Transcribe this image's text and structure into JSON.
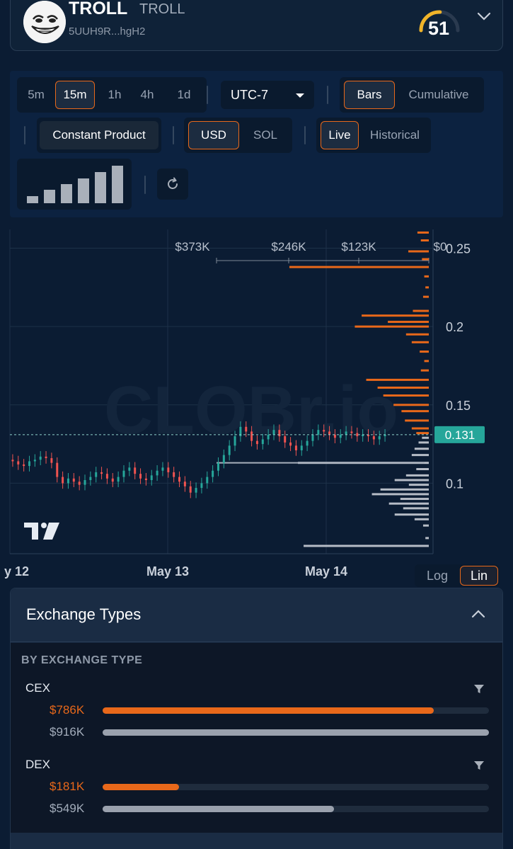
{
  "token": {
    "name": "TROLL",
    "symbol": "TROLL",
    "address": "5UUH9R...hgH2",
    "score": "51",
    "score_fraction": 0.51,
    "icons": {
      "avatar": "troll-face",
      "expand": "chevron-down-icon"
    }
  },
  "controls": {
    "timeframes": [
      "5m",
      "15m",
      "1h",
      "4h",
      "1d"
    ],
    "timeframe_selected": "15m",
    "timezone": "UTC-7",
    "view_modes": [
      "Bars",
      "Cumulative"
    ],
    "view_mode_selected": "Bars",
    "model": "Constant Product",
    "currencies": [
      "USD",
      "SOL"
    ],
    "currency_selected": "USD",
    "data_modes": [
      "Live",
      "Historical"
    ],
    "data_mode_selected": "Live",
    "icons": {
      "bars_widget": "signal-bars-icon",
      "refresh": "refresh-icon"
    }
  },
  "chart_data": {
    "type": "candlestick_with_depth",
    "watermark": "CLOBr.io",
    "x_ticks": [
      "y 12",
      "May 13",
      "May 14"
    ],
    "y_ticks": [
      0.25,
      0.2,
      0.15,
      0.1
    ],
    "y_range": [
      0.055,
      0.262
    ],
    "current_price": 0.131,
    "current_price_label": "0.131",
    "depth_scale_ticks": [
      "$373K",
      "$246K",
      "$123K",
      "$0"
    ],
    "support_level": 0.113,
    "price_series": [
      0.114,
      0.112,
      0.111,
      0.114,
      0.115,
      0.117,
      0.116,
      0.113,
      0.104,
      0.1,
      0.103,
      0.101,
      0.099,
      0.102,
      0.104,
      0.107,
      0.106,
      0.103,
      0.101,
      0.104,
      0.108,
      0.11,
      0.106,
      0.103,
      0.102,
      0.105,
      0.108,
      0.11,
      0.107,
      0.104,
      0.101,
      0.098,
      0.094,
      0.097,
      0.1,
      0.104,
      0.108,
      0.113,
      0.118,
      0.124,
      0.13,
      0.136,
      0.133,
      0.127,
      0.125,
      0.128,
      0.131,
      0.134,
      0.13,
      0.126,
      0.124,
      0.121,
      0.124,
      0.127,
      0.131,
      0.134,
      0.133,
      0.131,
      0.129,
      0.131,
      0.133,
      0.132,
      0.13,
      0.131,
      0.13,
      0.128,
      0.13,
      0.131
    ],
    "ask_depth": [
      {
        "price": 0.26,
        "value": 20
      },
      {
        "price": 0.255,
        "value": 14
      },
      {
        "price": 0.248,
        "value": 36
      },
      {
        "price": 0.243,
        "value": 12
      },
      {
        "price": 0.238,
        "value": 245
      },
      {
        "price": 0.232,
        "value": 8
      },
      {
        "price": 0.225,
        "value": 6
      },
      {
        "price": 0.219,
        "value": 10
      },
      {
        "price": 0.21,
        "value": 28
      },
      {
        "price": 0.207,
        "value": 118
      },
      {
        "price": 0.203,
        "value": 72
      },
      {
        "price": 0.2,
        "value": 130
      },
      {
        "price": 0.195,
        "value": 40
      },
      {
        "price": 0.19,
        "value": 30
      },
      {
        "price": 0.184,
        "value": 16
      },
      {
        "price": 0.178,
        "value": 8
      },
      {
        "price": 0.172,
        "value": 14
      },
      {
        "price": 0.166,
        "value": 110
      },
      {
        "price": 0.161,
        "value": 90
      },
      {
        "price": 0.156,
        "value": 80
      },
      {
        "price": 0.15,
        "value": 62
      },
      {
        "price": 0.146,
        "value": 48
      },
      {
        "price": 0.14,
        "value": 42
      },
      {
        "price": 0.135,
        "value": 30
      },
      {
        "price": 0.132,
        "value": 22
      }
    ],
    "bid_depth": [
      {
        "price": 0.129,
        "value": 12
      },
      {
        "price": 0.126,
        "value": 18
      },
      {
        "price": 0.122,
        "value": 25
      },
      {
        "price": 0.118,
        "value": 30
      },
      {
        "price": 0.113,
        "value": 230
      },
      {
        "price": 0.109,
        "value": 22
      },
      {
        "price": 0.105,
        "value": 40
      },
      {
        "price": 0.102,
        "value": 60
      },
      {
        "price": 0.099,
        "value": 35
      },
      {
        "price": 0.096,
        "value": 85
      },
      {
        "price": 0.093,
        "value": 100
      },
      {
        "price": 0.09,
        "value": 50
      },
      {
        "price": 0.087,
        "value": 70
      },
      {
        "price": 0.084,
        "value": 45
      },
      {
        "price": 0.08,
        "value": 60
      },
      {
        "price": 0.077,
        "value": 25
      },
      {
        "price": 0.073,
        "value": 10
      },
      {
        "price": 0.065,
        "value": 6
      },
      {
        "price": 0.06,
        "value": 220
      }
    ],
    "scale_labels": [
      "Log",
      "Lin"
    ],
    "scale_selected": "Lin"
  },
  "exchange_types": {
    "title": "Exchange Types",
    "section_label": "BY EXCHANGE TYPE",
    "groups": [
      {
        "name": "CEX",
        "rows": [
          {
            "label": "$786K",
            "fraction": 0.858,
            "color": "orange"
          },
          {
            "label": "$916K",
            "fraction": 1.0,
            "color": "gray"
          }
        ]
      },
      {
        "name": "DEX",
        "rows": [
          {
            "label": "$181K",
            "fraction": 0.198,
            "color": "orange"
          },
          {
            "label": "$549K",
            "fraction": 0.599,
            "color": "gray"
          }
        ]
      }
    ],
    "icons": {
      "collapse": "chevron-up-icon",
      "filter": "filter-icon"
    }
  },
  "colors": {
    "accent": "#e8681a",
    "up": "#26a69a",
    "down": "#ef5350",
    "price_tag": "#26a69a",
    "background": "#0b1c33"
  }
}
